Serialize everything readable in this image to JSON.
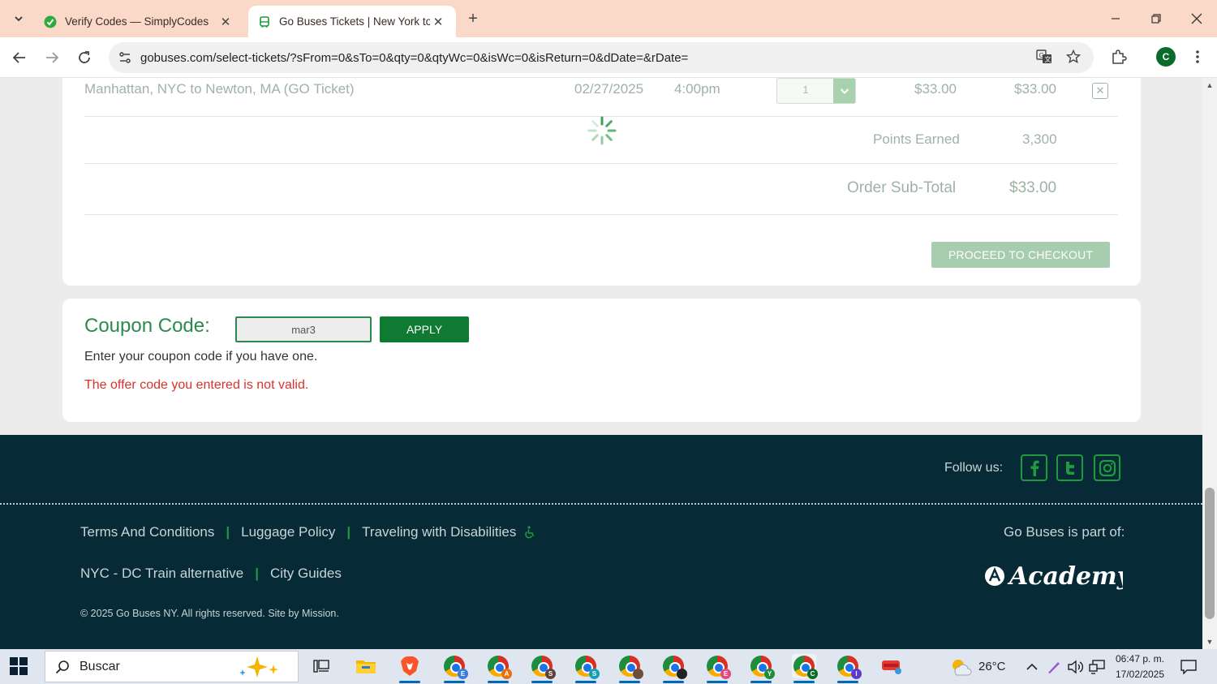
{
  "browser": {
    "tabs": [
      {
        "title": "Verify Codes — SimplyCodes",
        "active": false
      },
      {
        "title": "Go Buses Tickets | New York to",
        "active": true
      }
    ],
    "url": "gobuses.com/select-tickets/?sFrom=0&sTo=0&qty=0&qtyWc=0&isWc=0&isReturn=0&dDate=&rDate=",
    "profile_initial": "C"
  },
  "order": {
    "route": "Manhattan, NYC to Newton, MA (GO Ticket)",
    "date": "02/27/2025",
    "time": "4:00pm",
    "quantity": "1",
    "price": "$33.00",
    "line_total": "$33.00",
    "points_label": "Points Earned",
    "points_value": "3,300",
    "subtotal_label": "Order Sub-Total",
    "subtotal_value": "$33.00",
    "checkout_label": "PROCEED TO CHECKOUT"
  },
  "coupon": {
    "label": "Coupon Code:",
    "value": "mar3",
    "apply_label": "APPLY",
    "help": "Enter your coupon code if you have one.",
    "error": "The offer code you entered is not valid."
  },
  "footer": {
    "follow_label": "Follow us:",
    "links_row1": [
      "Terms And Conditions",
      "Luggage Policy",
      "Traveling with Disabilities"
    ],
    "links_row2": [
      "NYC - DC Train alternative",
      "City Guides"
    ],
    "part_of": "Go Buses is part of:",
    "copyright": "© 2025 Go Buses NY. All rights reserved. Site by Mission.",
    "brand": "Academy"
  },
  "taskbar": {
    "search_placeholder": "Buscar",
    "weather": "26°C",
    "time": "06:47 p. m.",
    "date": "17/02/2025"
  },
  "colors": {
    "brand_green": "#0f7a32",
    "error_red": "#d9312b",
    "footer_bg": "#062a36",
    "tabbar_bg": "#fbd9c9"
  }
}
